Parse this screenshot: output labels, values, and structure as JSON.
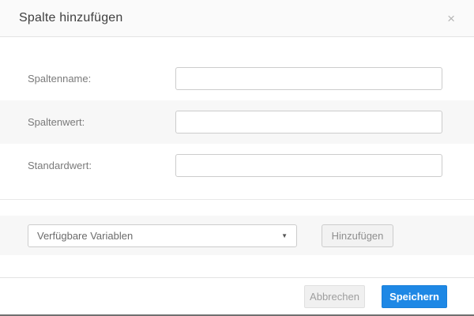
{
  "dialog": {
    "title": "Spalte hinzufügen",
    "close_icon": "×"
  },
  "form": {
    "fields": [
      {
        "label": "Spaltenname:",
        "value": ""
      },
      {
        "label": "Spaltenwert:",
        "value": ""
      },
      {
        "label": "Standardwert:",
        "value": ""
      }
    ]
  },
  "variables": {
    "select_value": "Verfügbare Variablen",
    "caret_icon": "▼",
    "add_button_label": "Hinzufügen"
  },
  "footer": {
    "cancel_label": "Abbrechen",
    "save_label": "Speichern"
  },
  "colors": {
    "accent_blue": "#1e88e5",
    "row_alt_bg": "#f7f7f7",
    "header_bg": "#fafafa",
    "border_light": "#e3e3e3",
    "input_border": "#cccccc",
    "bottom_edge": "#707070"
  }
}
